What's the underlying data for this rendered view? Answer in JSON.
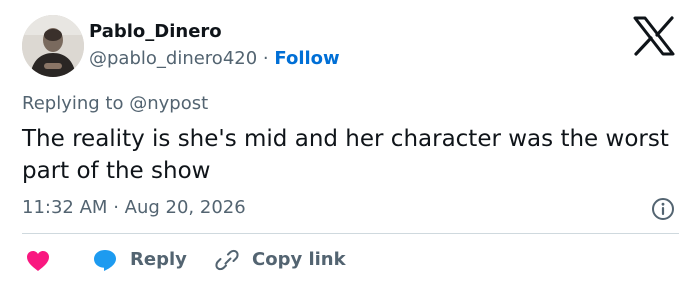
{
  "author": {
    "name": "Pablo_Dinero",
    "handle": "@pablo_dinero420",
    "separator": "·",
    "follow_label": "Follow"
  },
  "tweet": {
    "replying_prefix": "Replying to",
    "replying_to": "@nypost",
    "text": "The reality is she's mid and her character was the worst part of the show",
    "time": "11:32 AM",
    "date_separator": "·",
    "date": "Aug 20, 2026"
  },
  "actions": {
    "reply_label": "Reply",
    "copy_link_label": "Copy link"
  },
  "icons": {
    "brand": "x-logo-icon",
    "info": "info-icon",
    "like": "heart-icon",
    "reply": "reply-bubble-icon",
    "copy": "link-icon"
  },
  "colors": {
    "link": "#006fd6",
    "muted": "#536471",
    "text": "#0f1419",
    "heart": "#f91880",
    "reply_bubble": "#1d9bf0",
    "divider": "#cfd9de"
  }
}
